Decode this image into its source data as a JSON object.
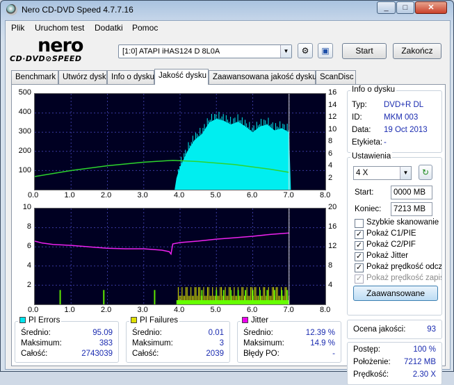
{
  "window": {
    "title": "Nero CD-DVD Speed 4.7.7.16",
    "minimize": "_",
    "maximize": "□",
    "close": "✕"
  },
  "menu": [
    "Plik",
    "Uruchom test",
    "Dodatki",
    "Pomoc"
  ],
  "logo": {
    "top": "nero",
    "bottom": "CD·DVD⊘SPEED"
  },
  "toolbar": {
    "drive": "[1:0]   ATAPI iHAS124   D 8L0A",
    "start": "Start",
    "end": "Zakończ"
  },
  "tabs": [
    "Benchmark",
    "Utwórz dysk",
    "Info o dysku",
    "Jakość dysku",
    "Zaawansowana jakość dysku",
    "ScanDisc"
  ],
  "active_tab": 3,
  "disc_info": {
    "title": "Info o dysku",
    "type_label": "Typ:",
    "type": "DVD+R DL",
    "id_label": "ID:",
    "id": "MKM 003",
    "date_label": "Data:",
    "date": "19 Oct 2013",
    "tag_label": "Etykieta:",
    "tag": "-"
  },
  "settings": {
    "title": "Ustawienia",
    "speed": "4 X",
    "start_label": "Start:",
    "start": "0000 MB",
    "end_label": "Koniec:",
    "end": "7213 MB",
    "checks": [
      {
        "label": "Szybkie skanowanie",
        "checked": false,
        "disabled": false
      },
      {
        "label": "Pokaż C1/PIE",
        "checked": true,
        "disabled": false
      },
      {
        "label": "Pokaż C2/PIF",
        "checked": true,
        "disabled": false
      },
      {
        "label": "Pokaż Jitter",
        "checked": true,
        "disabled": false
      },
      {
        "label": "Pokaż prędkość odczytu",
        "checked": true,
        "disabled": false
      },
      {
        "label": "Pokaż prędkość zapisu",
        "checked": true,
        "disabled": true
      }
    ],
    "advanced": "Zaawansowane"
  },
  "quality": {
    "label": "Ocena jakości:",
    "value": "93"
  },
  "progress": {
    "postep_label": "Postęp:",
    "postep": "100 %",
    "pos_label": "Położenie:",
    "pos": "7212 MB",
    "speed_label": "Prędkość:",
    "speed": "2.30 X"
  },
  "stats": {
    "pie": {
      "title": "PI Errors",
      "color": "#00e5ee",
      "avg_label": "Średnio:",
      "avg": "95.09",
      "max_label": "Maksimum:",
      "max": "383",
      "total_label": "Całość:",
      "total": "2743039"
    },
    "pif": {
      "title": "PI Failures",
      "color": "#e0e000",
      "avg_label": "Średnio:",
      "avg": "0.01",
      "max_label": "Maksimum:",
      "max": "3",
      "total_label": "Całość:",
      "total": "2039"
    },
    "jitter": {
      "title": "Jitter",
      "color": "#ee00ee",
      "avg_label": "Średnio:",
      "avg": "12.39 %",
      "max_label": "Maksimum:",
      "max": "14.9 %",
      "po_label": "Błędy PO:",
      "po": "-"
    }
  },
  "chart_data": [
    {
      "type": "area",
      "name": "PI Errors",
      "x_ticks": [
        "0.0",
        "1.0",
        "2.0",
        "3.0",
        "4.0",
        "5.0",
        "6.0",
        "7.0",
        "8.0"
      ],
      "y_left_ticks": [
        "500",
        "400",
        "300",
        "200",
        "100"
      ],
      "y_right_ticks": [
        "16",
        "14",
        "12",
        "10",
        "8",
        "6",
        "4",
        "2"
      ],
      "xlim": [
        0,
        8
      ],
      "ylim": [
        0,
        500
      ],
      "y2lim": [
        0,
        16
      ],
      "grid": true,
      "pie_series": {
        "x": [
          0,
          3.85,
          3.9,
          4.0,
          4.2,
          4.4,
          4.6,
          4.8,
          5.0,
          5.2,
          5.4,
          5.6,
          5.8,
          6.0,
          6.2,
          6.4,
          6.6,
          6.8,
          7.0,
          7.05
        ],
        "y": [
          0,
          0,
          60,
          120,
          200,
          260,
          290,
          350,
          370,
          360,
          340,
          355,
          330,
          300,
          330,
          340,
          310,
          320,
          300,
          0
        ]
      },
      "speed_series": {
        "x": [
          0,
          1,
          2,
          3,
          3.8,
          4.5,
          5.5,
          6.5,
          7.0
        ],
        "y": [
          2.2,
          3.2,
          4.0,
          4.6,
          4.9,
          4.7,
          4.2,
          3.4,
          2.9
        ]
      }
    },
    {
      "type": "bar",
      "name": "PI Failures / Jitter",
      "x_ticks": [
        "0.0",
        "1.0",
        "2.0",
        "3.0",
        "4.0",
        "5.0",
        "6.0",
        "7.0",
        "8.0"
      ],
      "y_left_ticks": [
        "10",
        "8",
        "6",
        "4",
        "2"
      ],
      "y_right_ticks": [
        "20",
        "16",
        "12",
        "8",
        "4"
      ],
      "xlim": [
        0,
        8
      ],
      "ylim": [
        0,
        10
      ],
      "y2lim": [
        0,
        20
      ],
      "jitter_series": {
        "x": [
          0,
          0.2,
          0.5,
          1.0,
          1.5,
          2.0,
          2.5,
          3.0,
          3.5,
          3.7,
          3.75,
          3.8,
          4.0,
          4.5,
          5.0,
          5.5,
          6.0,
          6.5,
          7.0
        ],
        "y": [
          13.2,
          12.8,
          12.5,
          12.3,
          12.0,
          11.7,
          11.6,
          11.6,
          11.3,
          11.0,
          10.5,
          12.6,
          12.9,
          13.2,
          13.6,
          13.9,
          14.2,
          14.6,
          14.9
        ]
      },
      "pif_bars_x": [
        0.7,
        1.9,
        3.3,
        4.6,
        5.0,
        5.2,
        5.4,
        5.6,
        5.8,
        6.0,
        6.2,
        6.4,
        6.6,
        6.8,
        6.95
      ]
    }
  ]
}
